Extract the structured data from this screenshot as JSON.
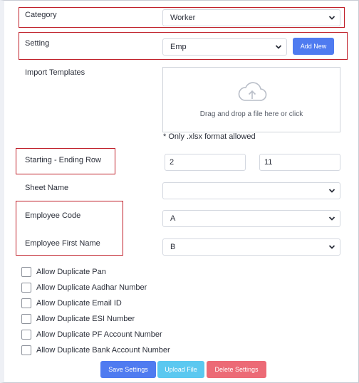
{
  "form": {
    "category": {
      "label": "Category",
      "value": "Worker"
    },
    "setting": {
      "label": "Setting",
      "value": "Emp",
      "add_new_label": "Add New"
    },
    "import_templates": {
      "label": "Import Templates",
      "dropzone_text": "Drag and drop a file here or click",
      "format_note": "* Only .xlsx format allowed"
    },
    "row_range": {
      "label": "Starting - Ending Row",
      "start": "2",
      "end": "11"
    },
    "sheet_name": {
      "label": "Sheet Name",
      "value": ""
    },
    "employee_code": {
      "label": "Employee Code",
      "value": "A"
    },
    "employee_first_name": {
      "label": "Employee First Name",
      "value": "B"
    }
  },
  "checkboxes": [
    {
      "label": "Allow Duplicate Pan"
    },
    {
      "label": "Allow Duplicate Aadhar Number"
    },
    {
      "label": "Allow Duplicate Email ID"
    },
    {
      "label": "Allow Duplicate ESI Number"
    },
    {
      "label": "Allow Duplicate PF Account Number"
    },
    {
      "label": "Allow Duplicate Bank Account Number"
    }
  ],
  "actions": {
    "save_label": "Save Settings",
    "upload_label": "Upload File",
    "delete_label": "Delete Settings"
  },
  "colors": {
    "primary": "#4f7bf0",
    "info": "#5bc8f0",
    "danger": "#ec6a76",
    "highlight": "#c0202a"
  },
  "icons": {
    "upload": "cloud-upload-icon",
    "dropdown": "chevron-down-icon"
  }
}
